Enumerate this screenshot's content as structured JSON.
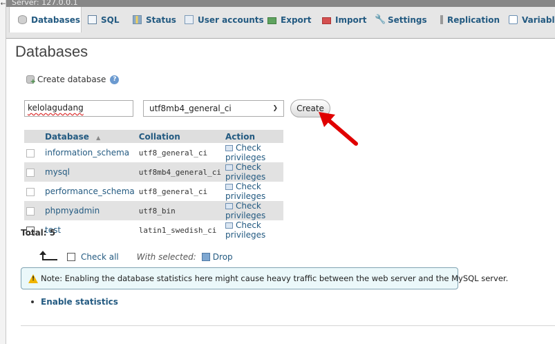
{
  "server": {
    "label": "Server: 127.0.0.1"
  },
  "tabs": [
    {
      "label": "Databases",
      "icon": "database-icon",
      "active": true
    },
    {
      "label": "SQL",
      "icon": "sql-icon"
    },
    {
      "label": "Status",
      "icon": "status-icon"
    },
    {
      "label": "User accounts",
      "icon": "user-accounts-icon"
    },
    {
      "label": "Export",
      "icon": "export-icon"
    },
    {
      "label": "Import",
      "icon": "import-icon"
    },
    {
      "label": "Settings",
      "icon": "settings-icon"
    },
    {
      "label": "Replication",
      "icon": "replication-icon"
    },
    {
      "label": "Variables",
      "icon": "variables-icon"
    }
  ],
  "page": {
    "title": "Databases"
  },
  "create_db": {
    "label": "Create database",
    "name_value": "kelolagudang",
    "collation_value": "utf8mb4_general_ci",
    "create_label": "Create"
  },
  "table": {
    "headers": {
      "database": "Database",
      "sort_marker": "▲",
      "collation": "Collation",
      "action": "Action"
    },
    "rows": [
      {
        "database": "information_schema",
        "collation": "utf8_general_ci",
        "action": "Check privileges"
      },
      {
        "database": "mysql",
        "collation": "utf8mb4_general_ci",
        "action": "Check privileges"
      },
      {
        "database": "performance_schema",
        "collation": "utf8_general_ci",
        "action": "Check privileges"
      },
      {
        "database": "phpmyadmin",
        "collation": "utf8_bin",
        "action": "Check privileges"
      },
      {
        "database": "test",
        "collation": "latin1_swedish_ci",
        "action": "Check privileges"
      }
    ]
  },
  "total": "Total: 5",
  "bulk": {
    "check_all": "Check all",
    "with_selected": "With selected:",
    "drop": "Drop"
  },
  "notice": "Note: Enabling the database statistics here might cause heavy traffic between the web server and the MySQL server.",
  "enable_stats": "Enable statistics",
  "colors": {
    "link": "#235a81",
    "arrow": "#e00000",
    "notice_bg": "#ebf8fa"
  }
}
